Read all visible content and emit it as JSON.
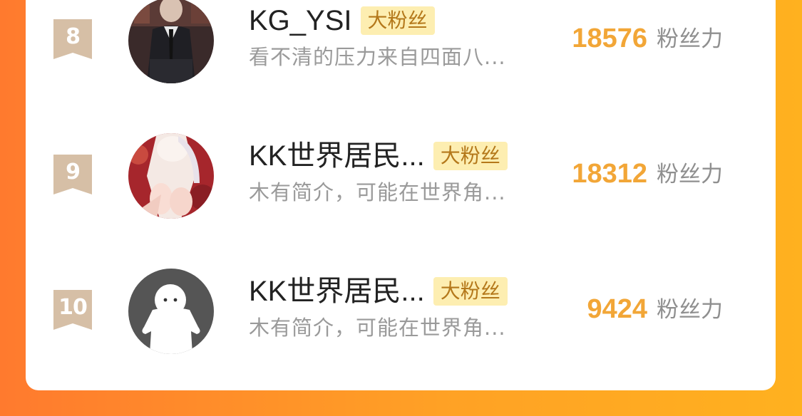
{
  "colors": {
    "score": "#f2a637",
    "badge_bg": "#fdeeb1",
    "badge_text": "#b4781a",
    "rank_ribbon": "#d6bfa6",
    "background_start": "#ff7a2e",
    "background_end": "#ffb11f"
  },
  "fans": [
    {
      "rank": "8",
      "username": "KG_YSI",
      "badge": "大粉丝",
      "bio": "看不清的压力来自四面八...",
      "score": "18576",
      "score_unit": "粉丝力",
      "avatar": "man-in-suit-avatar"
    },
    {
      "rank": "9",
      "username": "KK世界居民...",
      "badge": "大粉丝",
      "bio": "木有简介，可能在世界角...",
      "score": "18312",
      "score_unit": "粉丝力",
      "avatar": "anime-girl-avatar"
    },
    {
      "rank": "10",
      "username": "KK世界居民...",
      "badge": "大粉丝",
      "bio": "木有简介，可能在世界角...",
      "score": "9424",
      "score_unit": "粉丝力",
      "avatar": "default-ghost-avatar"
    }
  ]
}
